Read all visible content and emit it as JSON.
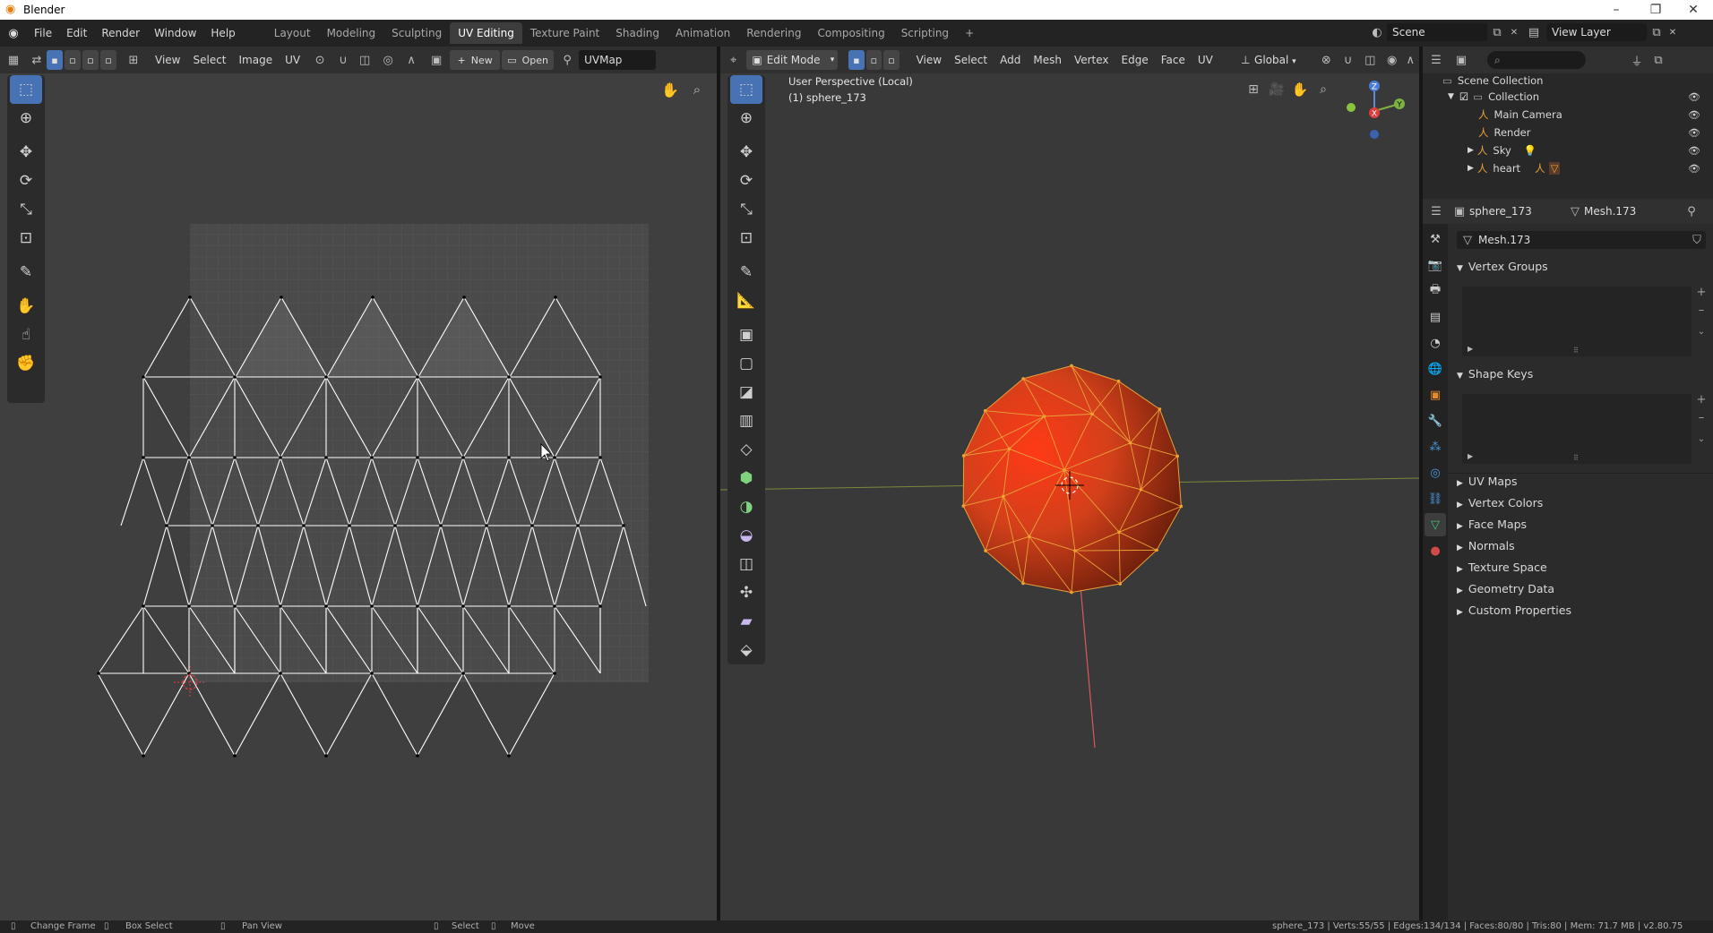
{
  "window": {
    "title": "Blender",
    "minimize": "–",
    "restore": "❐",
    "close": "✕"
  },
  "menu": [
    "File",
    "Edit",
    "Render",
    "Window",
    "Help"
  ],
  "workspaces": [
    "Layout",
    "Modeling",
    "Sculpting",
    "UV Editing",
    "Texture Paint",
    "Shading",
    "Animation",
    "Rendering",
    "Compositing",
    "Scripting",
    "+"
  ],
  "active_workspace": "UV Editing",
  "scene": {
    "label": "Scene",
    "view_layer": "View Layer"
  },
  "uv_header": {
    "menus": [
      "View",
      "Select",
      "Image",
      "UV"
    ],
    "new_label": "New",
    "open_label": "Open",
    "uvmap": "UVMap"
  },
  "vp_header": {
    "mode": "Edit Mode",
    "menus": [
      "View",
      "Select",
      "Add",
      "Mesh",
      "Vertex",
      "Edge",
      "Face",
      "UV"
    ],
    "orientation": "Global"
  },
  "viewport": {
    "perspective": "User Perspective (Local)",
    "object": "(1) sphere_173",
    "axis_x": "X",
    "axis_y": "Y",
    "axis_z": "Z"
  },
  "outliner": {
    "scene_collection": "Scene Collection",
    "collection": "Collection",
    "items": [
      "Main Camera",
      "Render",
      "Sky",
      "heart"
    ]
  },
  "properties": {
    "object": "sphere_173",
    "mesh": "Mesh.173",
    "mesh_field": "Mesh.173",
    "panels": {
      "vertex_groups": "Vertex Groups",
      "shape_keys": "Shape Keys"
    },
    "collapsed": [
      "UV Maps",
      "Vertex Colors",
      "Face Maps",
      "Normals",
      "Texture Space",
      "Geometry Data",
      "Custom Properties"
    ]
  },
  "status": {
    "left": [
      "Change Frame",
      "Box Select",
      "Pan View",
      "Select",
      "Move"
    ],
    "right": "sphere_173 | Verts:55/55 | Edges:134/134 | Faces:80/80 | Tris:80 | Mem: 71.7 MB | v2.80.75"
  },
  "colors": {
    "accent": "#4772b3",
    "uv_bg": "#3f3f3f",
    "viewport_bg": "#393939",
    "sphere": "#d8461c",
    "wire": "#e8a23a"
  }
}
